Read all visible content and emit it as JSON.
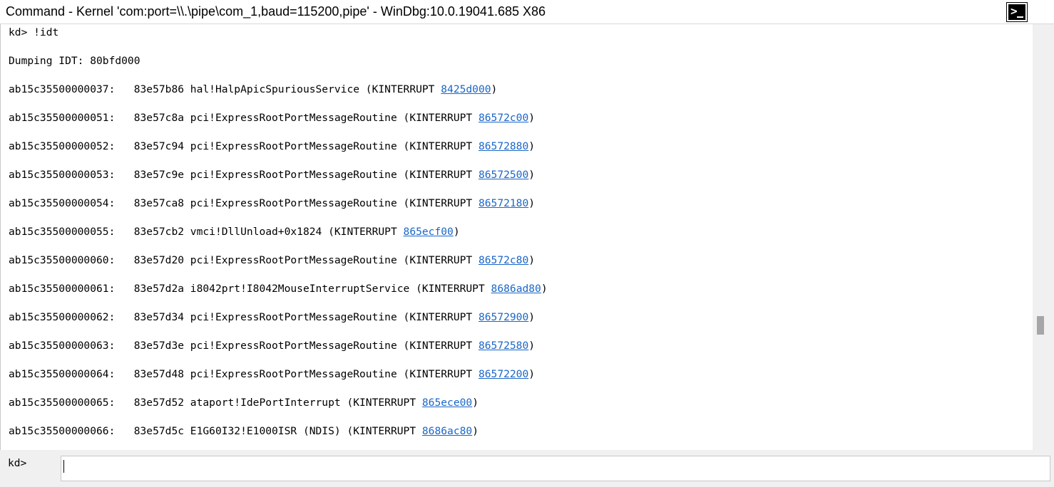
{
  "window": {
    "title": "Command - Kernel 'com:port=\\\\.\\pipe\\com_1,baud=115200,pipe' - WinDbg:10.0.19041.685 X86"
  },
  "output": {
    "command_echo": "kd> !idt",
    "dump_header": "Dumping IDT: 80bfd000",
    "entries": [
      {
        "text": "ab15c35500000037:   83e57b86 hal!HalpApicSpuriousService (KINTERRUPT ",
        "link": "8425d000",
        "suffix": ")"
      },
      {
        "text": "ab15c35500000051:   83e57c8a pci!ExpressRootPortMessageRoutine (KINTERRUPT ",
        "link": "86572c00",
        "suffix": ")"
      },
      {
        "text": "ab15c35500000052:   83e57c94 pci!ExpressRootPortMessageRoutine (KINTERRUPT ",
        "link": "86572880",
        "suffix": ")"
      },
      {
        "text": "ab15c35500000053:   83e57c9e pci!ExpressRootPortMessageRoutine (KINTERRUPT ",
        "link": "86572500",
        "suffix": ")"
      },
      {
        "text": "ab15c35500000054:   83e57ca8 pci!ExpressRootPortMessageRoutine (KINTERRUPT ",
        "link": "86572180",
        "suffix": ")"
      },
      {
        "text": "ab15c35500000055:   83e57cb2 vmci!DllUnload+0x1824 (KINTERRUPT ",
        "link": "865ecf00",
        "suffix": ")"
      },
      {
        "text": "ab15c35500000060:   83e57d20 pci!ExpressRootPortMessageRoutine (KINTERRUPT ",
        "link": "86572c80",
        "suffix": ")"
      },
      {
        "text": "ab15c35500000061:   83e57d2a i8042prt!I8042MouseInterruptService (KINTERRUPT ",
        "link": "8686ad80",
        "suffix": ")"
      },
      {
        "text": "ab15c35500000062:   83e57d34 pci!ExpressRootPortMessageRoutine (KINTERRUPT ",
        "link": "86572900",
        "suffix": ")"
      },
      {
        "text": "ab15c35500000063:   83e57d3e pci!ExpressRootPortMessageRoutine (KINTERRUPT ",
        "link": "86572580",
        "suffix": ")"
      },
      {
        "text": "ab15c35500000064:   83e57d48 pci!ExpressRootPortMessageRoutine (KINTERRUPT ",
        "link": "86572200",
        "suffix": ")"
      },
      {
        "text": "ab15c35500000065:   83e57d52 ataport!IdePortInterrupt (KINTERRUPT ",
        "link": "865ece00",
        "suffix": ")"
      },
      {
        "text": "ab15c35500000066:   83e57d5c E1G60I32!E1000ISR (NDIS) (KINTERRUPT ",
        "link": "8686ac80",
        "suffix": ")"
      }
    ]
  },
  "command_bar": {
    "prompt": "kd>",
    "input_value": ""
  },
  "icons": {
    "title_button": "command-prompt-icon"
  },
  "colors": {
    "link": "#1a66c8"
  }
}
